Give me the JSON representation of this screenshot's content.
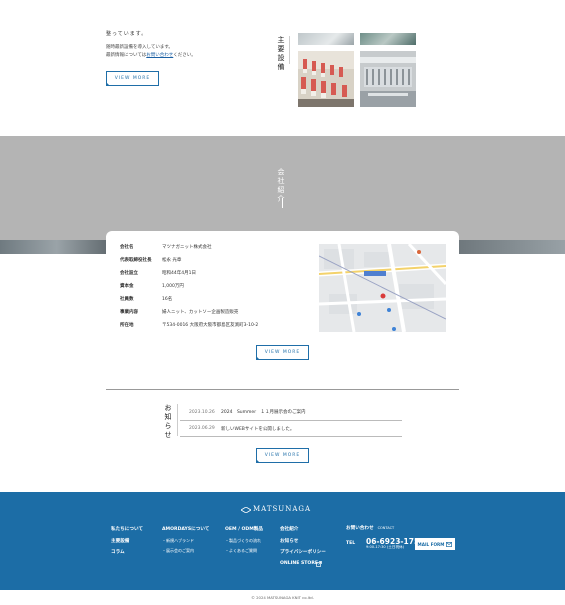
{
  "equipment": {
    "heading": "整っています。",
    "lines": [
      "随時最新設備を導入しています。",
      "最新情報については"
    ],
    "link": "お問い合わせ",
    "suffix": "ください。",
    "button": "VIEW MORE",
    "title": "主要設備"
  },
  "company": {
    "title": "会社紹介",
    "rows": [
      {
        "k": "会社名",
        "v": "マツナガニット株式会社"
      },
      {
        "k": "代表取締役社長",
        "v": "松永 光章"
      },
      {
        "k": "会社設立",
        "v": "昭和44年4月1日"
      },
      {
        "k": "資本金",
        "v": "1,000万円"
      },
      {
        "k": "社員数",
        "v": "16名"
      },
      {
        "k": "事業内容",
        "v": "婦人ニット、カットソー企画製造販売"
      },
      {
        "k": "所在地",
        "v": "〒534-0016 大阪府大阪市都島区友渕町3-10-2"
      }
    ],
    "button": "VIEW MORE"
  },
  "news": {
    "title": "お知らせ",
    "items": [
      {
        "date": "2023.10.26",
        "text": "2024　Summer　１１月展示会のご案内"
      },
      {
        "date": "2023.06.29",
        "text": "新しいWEBサイトを公開しました。"
      }
    ],
    "button": "VIEW MORE"
  },
  "footer": {
    "logo": "MATSUNAGA",
    "col1": [
      "私たちについて",
      "主要設備",
      "コラム"
    ],
    "col2": {
      "head": "AMORDAYSについて",
      "subs": [
        "・新規ハブランド",
        "・展示会のご案内"
      ]
    },
    "col3": {
      "head": "OEM / ODM製品",
      "subs": [
        "・製品づくりの流れ",
        "・よくあるご質問"
      ]
    },
    "col4": [
      "会社紹介",
      "お知らせ",
      "プライバシーポリシー",
      "ONLINE STORE"
    ],
    "contact": {
      "head": "お問い合わせ",
      "sub": "CONTACT",
      "tel_label": "TEL",
      "tel": "06-6923-1755",
      "hours": "9:00-17:30 (土日祝休)",
      "mail": "MAIL FORM"
    },
    "copyright": "© 2024 MATSUNAGA KNIT co.ltd."
  },
  "colors": {
    "brand": "#1c6da6",
    "band": "#b4b4b4"
  }
}
